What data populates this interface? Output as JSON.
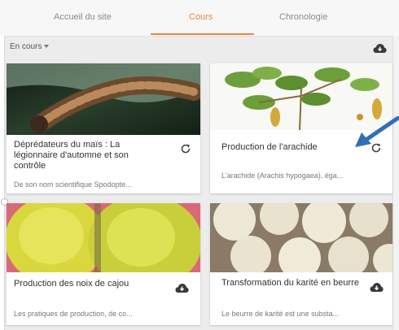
{
  "tabs": [
    {
      "label": "Accueil du site",
      "active": false
    },
    {
      "label": "Cours",
      "active": true
    },
    {
      "label": "Chronologie",
      "active": false
    }
  ],
  "filter": {
    "label": "En cours"
  },
  "download_icon": "cloud-download-icon",
  "cards": [
    {
      "title": "Déprédateurs du maïs : La légionnaire d'automne et son contrôle",
      "description": "De son nom scientifique Spodopte...",
      "status_icon": "refresh-icon"
    },
    {
      "title": "Production de l'arachide",
      "description": "L'arachide (Arachis hypogaea), éga...",
      "status_icon": "refresh-icon"
    },
    {
      "title": "Production des noix de cajou",
      "description": "Les pratiques de production, de co...",
      "status_icon": "cloud-download-icon"
    },
    {
      "title": "Transformation du karité en beurre",
      "description": "Le beurre de karité est une substa...",
      "status_icon": "cloud-download-icon"
    }
  ],
  "colors": {
    "accent": "#f0853b",
    "annotation_arrow": "#2f6fb8",
    "title_strip": "#e8231c"
  }
}
